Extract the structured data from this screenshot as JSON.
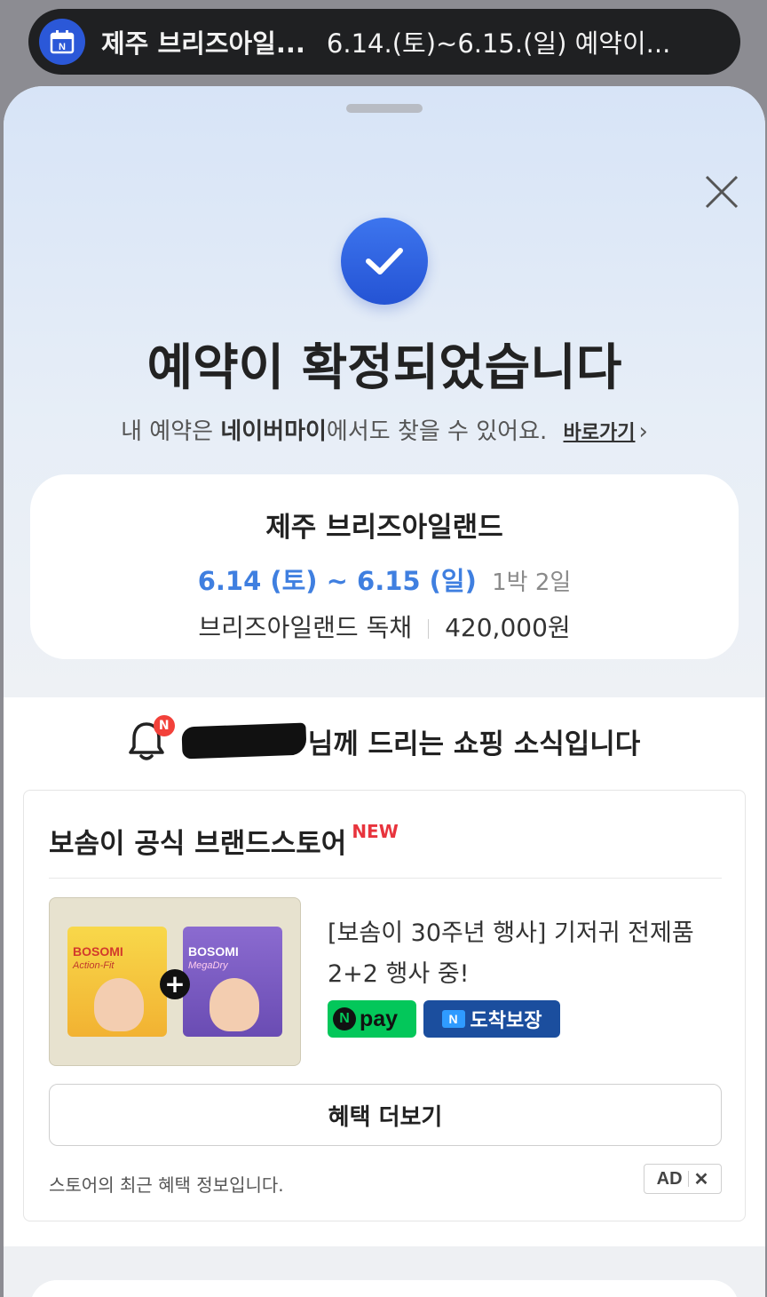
{
  "banner": {
    "title": "제주 브리즈아일...",
    "text": "6.14.(토)~6.15.(일) 예약이..."
  },
  "confirmation": {
    "title": "예약이 확정되었습니다",
    "sub_prefix": "내 예약은 ",
    "sub_strong": "네이버마이",
    "sub_suffix": "에서도 찾을 수 있어요.",
    "link": "바로가기",
    "link_chevron": "›"
  },
  "booking": {
    "place": "제주 브리즈아일랜드",
    "dates": "6.14 (토) ~ 6.15 (일)",
    "nights": "1박 2일",
    "room": "브리즈아일랜드 독채",
    "price": "420,000원"
  },
  "shopping": {
    "header_suffix": "님께 드리는 쇼핑 소식입니다",
    "bell_badge": "N",
    "store_name": "보솜이 공식 브랜드스토어",
    "new_tag": "NEW",
    "product_text": "[보솜이 30주년 행사] 기저귀 전제품 2+2 행사 중!",
    "pack_left_brand": "BOSOMI",
    "pack_left_sub": "Action-Fit",
    "pack_right_brand": "BOSOMI",
    "pack_right_sub": "MegaDry",
    "npay_n": "N",
    "npay_label": "pay",
    "arrive_n": "N",
    "arrive_label": "도착보장",
    "more_button": "혜택 더보기",
    "note": "스토어의 최근 혜택 정보입니다.",
    "ad_label": "AD",
    "ad_close": "✕"
  }
}
